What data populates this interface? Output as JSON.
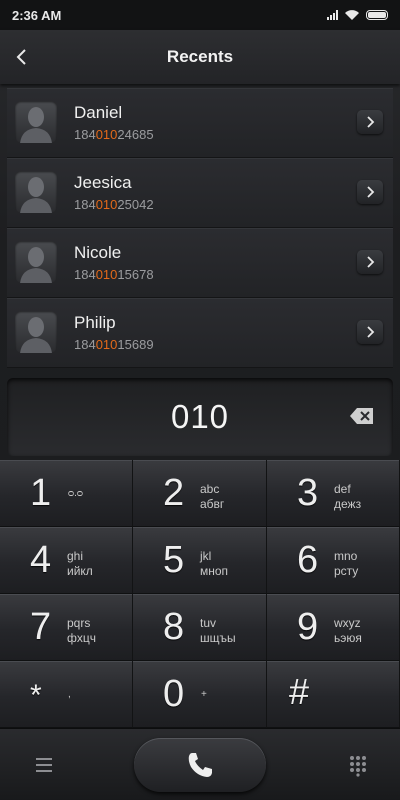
{
  "status": {
    "time": "2:36 AM"
  },
  "header": {
    "title": "Recents"
  },
  "contacts": [
    {
      "name": "Daniel",
      "number_prefix": "184",
      "number_match": "010",
      "number_suffix": "24685"
    },
    {
      "name": "Jeesica",
      "number_prefix": "184",
      "number_match": "010",
      "number_suffix": "25042"
    },
    {
      "name": "Nicole",
      "number_prefix": "184",
      "number_match": "010",
      "number_suffix": "15678"
    },
    {
      "name": "Philip",
      "number_prefix": "184",
      "number_match": "010",
      "number_suffix": "15689"
    }
  ],
  "display": {
    "number": "010"
  },
  "keys": [
    {
      "digit": "1",
      "letters": "ᴑ.ᴑ"
    },
    {
      "digit": "2",
      "letters": "abc",
      "letters_alt": "абвг"
    },
    {
      "digit": "3",
      "letters": "def",
      "letters_alt": "дежз"
    },
    {
      "digit": "4",
      "letters": "ghi",
      "letters_alt": "ийкл"
    },
    {
      "digit": "5",
      "letters": "jkl",
      "letters_alt": "мноп"
    },
    {
      "digit": "6",
      "letters": "mno",
      "letters_alt": "рсту"
    },
    {
      "digit": "7",
      "letters": "pqrs",
      "letters_alt": "фхцч"
    },
    {
      "digit": "8",
      "letters": "tuv",
      "letters_alt": "шщъы"
    },
    {
      "digit": "9",
      "letters": "wxyz",
      "letters_alt": "ьэюя"
    },
    {
      "digit": "*",
      "letters": ","
    },
    {
      "digit": "0",
      "letters": "+"
    },
    {
      "digit": "#",
      "letters": ""
    }
  ],
  "colors": {
    "accent": "#e36a1a",
    "text": "#f0f0f0",
    "subtext": "#9b9c9f"
  },
  "icons": {
    "back": "chevron-left-icon",
    "detail": "chevron-right-icon",
    "backspace": "backspace-icon",
    "menu": "menu-icon",
    "call": "phone-icon",
    "dialpad": "dialpad-icon"
  }
}
